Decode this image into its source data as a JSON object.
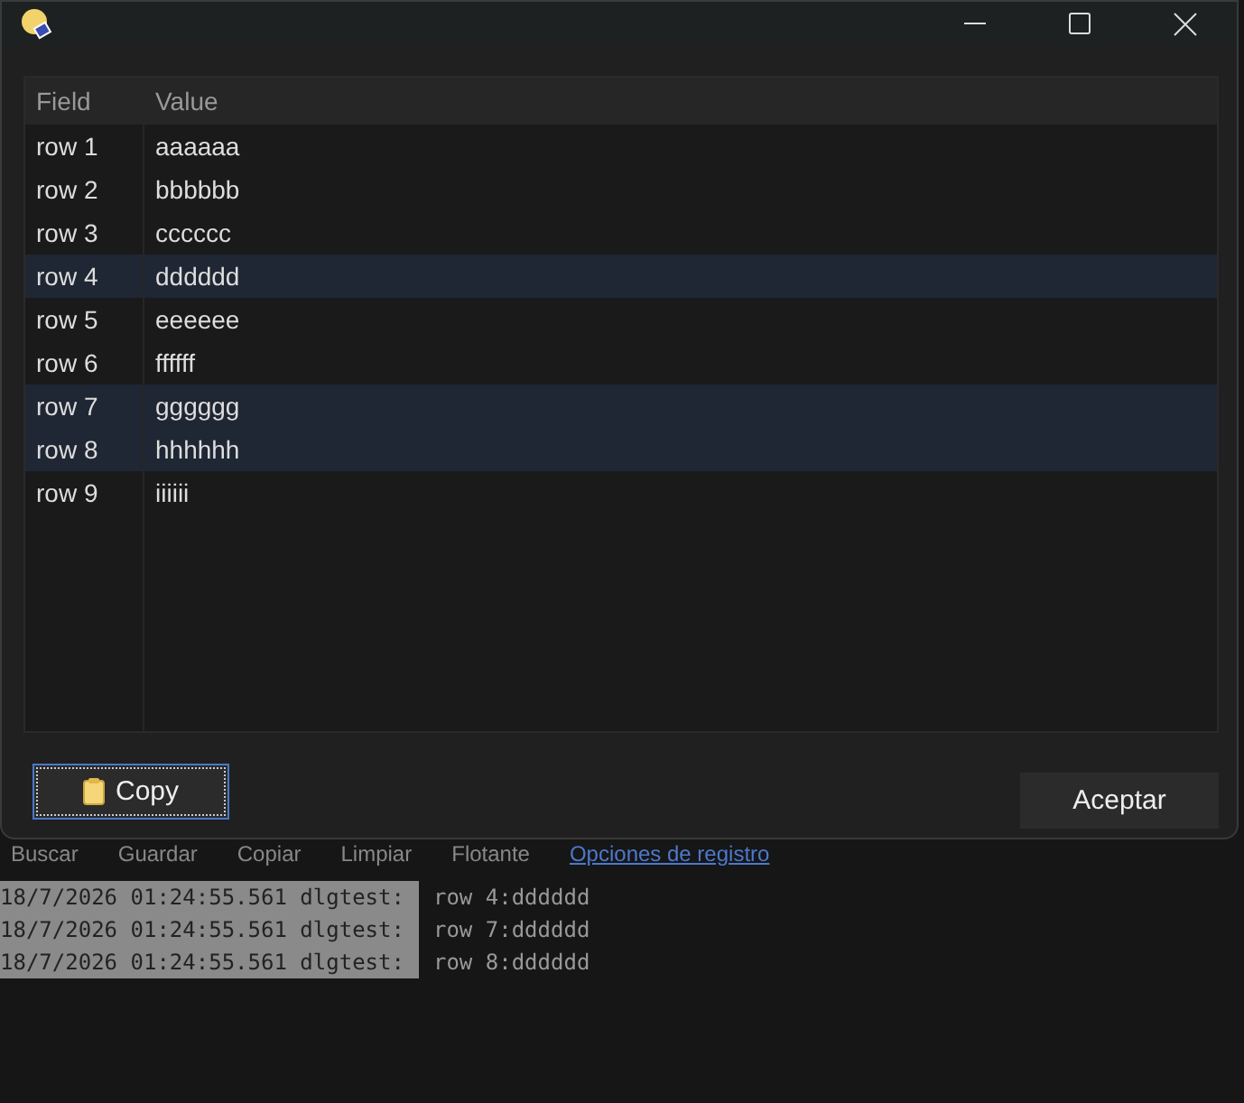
{
  "dialog": {
    "columns": [
      "Field",
      "Value"
    ],
    "rows": [
      {
        "field": "row 1",
        "value": "aaaaaa",
        "selected": false
      },
      {
        "field": "row 2",
        "value": "bbbbbb",
        "selected": false
      },
      {
        "field": "row 3",
        "value": "cccccc",
        "selected": false
      },
      {
        "field": "row 4",
        "value": "dddddd",
        "selected": true
      },
      {
        "field": "row 5",
        "value": "eeeeee",
        "selected": false
      },
      {
        "field": "row 6",
        "value": "ffffff",
        "selected": false
      },
      {
        "field": "row 7",
        "value": "gggggg",
        "selected": true
      },
      {
        "field": "row 8",
        "value": "hhhhhh",
        "selected": true
      },
      {
        "field": "row 9",
        "value": "iiiiii",
        "selected": false
      }
    ],
    "buttons": [
      {
        "label": "Copy",
        "focused": true
      },
      {
        "label": "Aceptar",
        "focused": false
      }
    ]
  },
  "toolbar": [
    {
      "label": "Buscar",
      "kind": "button"
    },
    {
      "label": "Guardar",
      "kind": "button"
    },
    {
      "label": "Copiar",
      "kind": "button"
    },
    {
      "label": "Limpiar",
      "kind": "button"
    },
    {
      "label": "Flotante",
      "kind": "button"
    },
    {
      "label": "Opciones de registro",
      "kind": "link"
    }
  ],
  "log": [
    {
      "prefix": "18/7/2026 01:24:55.561 dlgtest:",
      "message": "row 4:dddddd",
      "highlighted": true
    },
    {
      "prefix": "18/7/2026 01:24:55.561 dlgtest:",
      "message": "row 7:dddddd",
      "highlighted": true
    },
    {
      "prefix": "18/7/2026 01:24:55.561 dlgtest:",
      "message": "row 8:dddddd",
      "highlighted": true
    }
  ]
}
